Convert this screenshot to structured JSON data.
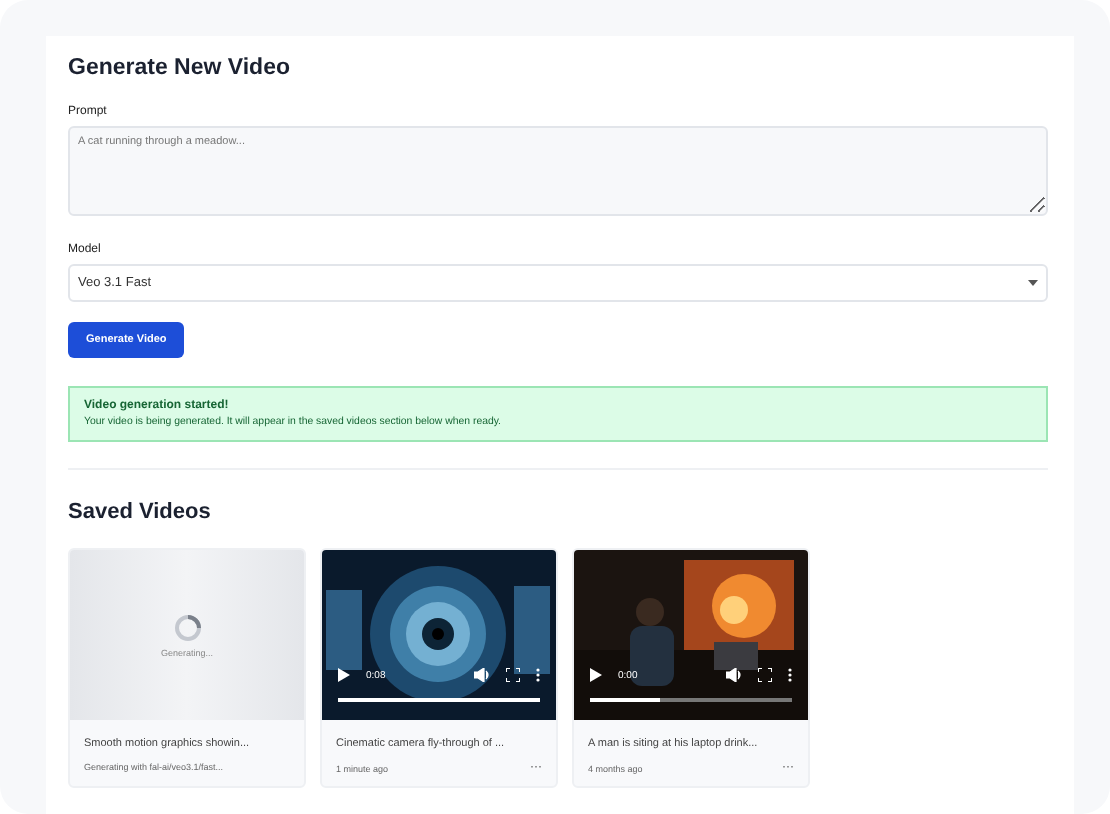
{
  "title": "Generate New Video",
  "prompt": {
    "label": "Prompt",
    "placeholder": "A cat running through a meadow..."
  },
  "model": {
    "label": "Model",
    "value": "Veo 3.1 Fast"
  },
  "generate_button": "Generate Video",
  "alert": {
    "title": "Video generation started!",
    "message": "Your video is being generated. It will appear in the saved videos section below when ready."
  },
  "saved_title": "Saved Videos",
  "videos": [
    {
      "kind": "generating",
      "status": "Generating...",
      "caption": "Smooth motion graphics showin...",
      "meta": "Generating with fal-ai/veo3.1/fast..."
    },
    {
      "kind": "video",
      "time": "0:08",
      "level": 1,
      "caption": "Cinematic camera fly-through of ...",
      "meta": "1 minute ago",
      "more": "···"
    },
    {
      "kind": "video",
      "time": "0:00",
      "level": 0.35,
      "caption": "A man is siting at his laptop drink...",
      "meta": "4 months ago",
      "more": "···"
    }
  ]
}
